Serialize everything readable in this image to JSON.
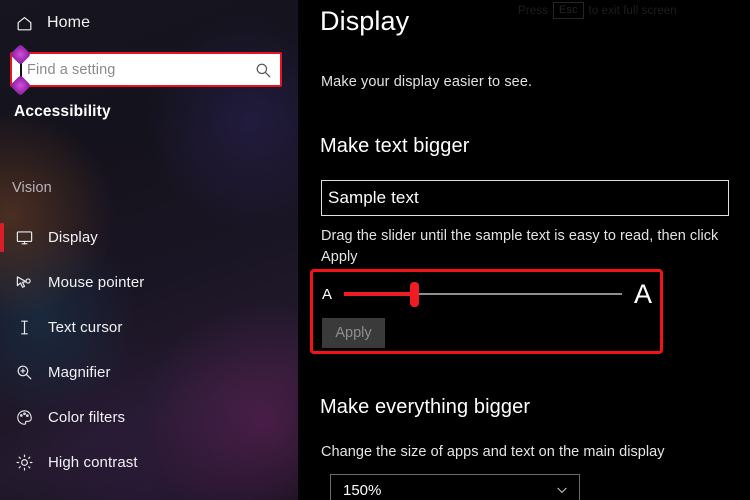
{
  "sidebar": {
    "home": {
      "label": "Home",
      "icon": "home-icon"
    },
    "search": {
      "placeholder": "Find a setting",
      "value": "",
      "icon": "search-icon"
    },
    "section_title": "Accessibility",
    "group_title": "Vision",
    "items": [
      {
        "label": "Display",
        "icon": "monitor-icon",
        "selected": true
      },
      {
        "label": "Mouse pointer",
        "icon": "mouse-pointer-icon",
        "selected": false
      },
      {
        "label": "Text cursor",
        "icon": "text-cursor-icon",
        "selected": false
      },
      {
        "label": "Magnifier",
        "icon": "magnifier-icon",
        "selected": false
      },
      {
        "label": "Color filters",
        "icon": "palette-icon",
        "selected": false
      },
      {
        "label": "High contrast",
        "icon": "brightness-icon",
        "selected": false
      }
    ]
  },
  "main": {
    "esc_overlay": {
      "prefix": "Press",
      "key": "Esc",
      "suffix": "to exit full screen"
    },
    "title": "Display",
    "subtitle": "Make your display easier to see.",
    "make_text_bigger": {
      "heading": "Make text bigger",
      "sample_text": "Sample text",
      "hint": "Drag the slider until the sample text is easy to read, then click Apply",
      "slider": {
        "min_label": "A",
        "max_label": "A",
        "value_percent": 25
      },
      "apply_label": "Apply"
    },
    "make_everything_bigger": {
      "heading": "Make everything bigger",
      "description": "Change the size of apps and text on the main display",
      "scale_value": "150%",
      "chevron": "chevron-down-icon"
    }
  },
  "colors": {
    "annotation_red": "#f41118",
    "slider_red": "#ef1c24",
    "selection_indicator": "#d81f27",
    "handle_purple": "#a32fb5",
    "panel_bg": "#000000"
  }
}
